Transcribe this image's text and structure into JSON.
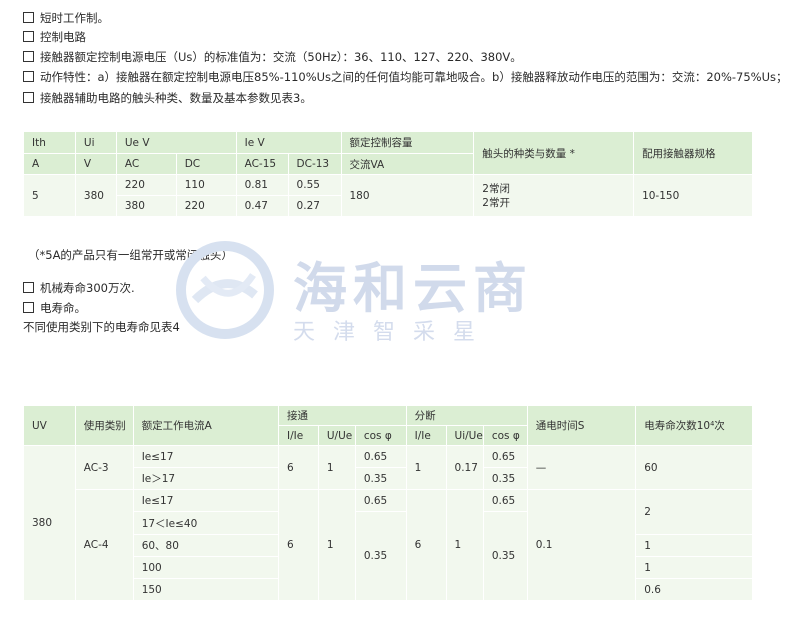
{
  "checklist": [
    "短时工作制。",
    "控制电路",
    "接触器额定控制电源电压（Us）的标准值为：交流（50Hz）：36、110、127、220、380V。",
    "动作特性：a）接触器在额定控制电源电压85%-110%Us之间的任何值均能可靠地吸合。b）接触器释放动作电压的范围为：交流：20%-75%Us；",
    "接触器辅助电路的触头种类、数量及基本参数见表3。"
  ],
  "table1": {
    "h": {
      "ith": "Ith",
      "ith_unit": "A",
      "ui": "Ui",
      "ui_unit": "V",
      "uev": "Ue V",
      "iev": "Ie V",
      "rated": "额定控制容量",
      "contact": "触头的种类与数量 *",
      "model": "配用接触器规格",
      "ac": "AC",
      "dc": "DC",
      "ac15": "AC-15",
      "dc13": "DC-13",
      "va": "交流VA"
    },
    "rows": [
      [
        "5",
        "380",
        "220",
        "110",
        "0.81",
        "0.55",
        "180",
        "2常闭",
        "10-150"
      ],
      [
        "",
        "",
        "380",
        "220",
        "0.47",
        "0.27",
        "",
        "2常开",
        ""
      ]
    ]
  },
  "note": "（*5A的产品只有一组常开或常闭触头）",
  "life_items": [
    "机械寿命300万次.",
    "电寿命。"
  ],
  "life_text": "不同使用类别下的电寿命见表4",
  "watermark": {
    "title": "海和云商",
    "sub": "天津智采星"
  },
  "table2": {
    "h": {
      "uv": "UV",
      "cat": "使用类别",
      "current": "额定工作电流A",
      "make": "接通",
      "break": "分断",
      "time": "通电时间S",
      "life": "电寿命次数10⁴次",
      "i_ie": "I/Ie",
      "u_ue": "U/Ue",
      "cos": "cos φ",
      "i_ie2": "I/Ie",
      "ui_ue": "Ui/Ue",
      "cos2": "cos φ"
    },
    "cells": {
      "uv": "380",
      "ac3": "AC-3",
      "ac4": "AC-4",
      "c1": "Ie≤17",
      "c2": "Ie＞17",
      "c3": "Ie≤17",
      "c4": "17＜Ie≤40",
      "c5": "60、80",
      "c6": "100",
      "c7": "150",
      "m_i1": "6",
      "m_u1": "1",
      "m_cos1": "0.65",
      "m_cos2": "0.35",
      "b_i1": "1",
      "b_u1": "0.17",
      "b_cos1": "0.65",
      "b_cos2": "0.35",
      "t1": "—",
      "l1": "60",
      "m_cos3": "0.65",
      "m_cos4": "0.35",
      "m_i2": "6",
      "m_u2": "1",
      "b_i2": "6",
      "b_u2": "1",
      "b_cos3": "0.65",
      "b_cos4": "0.35",
      "t2": "0.1",
      "l2": "2",
      "l3": "1",
      "l4": "1",
      "l5": "0.6"
    }
  }
}
